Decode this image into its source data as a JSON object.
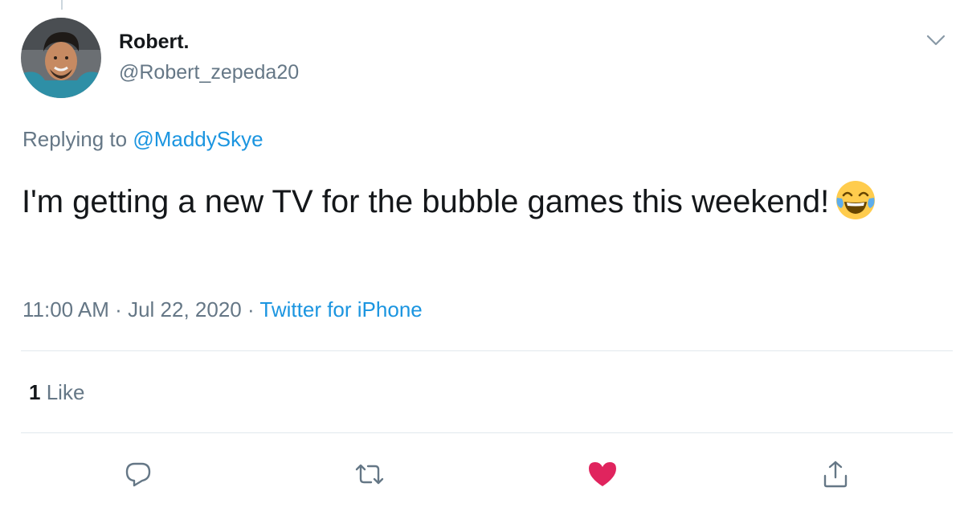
{
  "tweet": {
    "author": {
      "display_name": "Robert.",
      "handle": "@Robert_zepeda20"
    },
    "replying_prefix": "Replying to",
    "replying_handle": "@MaddySkye",
    "text": "I'm getting a new TV for the bubble games this weekend!",
    "emoji": "face-with-tears-of-joy-icon",
    "time": "11:00 AM",
    "separator_1": "·",
    "date": "Jul 22, 2020",
    "separator_2": "·",
    "source": "Twitter for iPhone",
    "likes_count": "1",
    "likes_label": "Like"
  },
  "colors": {
    "text_primary": "#14171a",
    "text_secondary": "#657786",
    "link": "#1b95e0",
    "like_heart": "#e0245e",
    "divider": "#e1e8ed"
  },
  "actions": [
    "reply-icon",
    "retweet-icon",
    "like-icon",
    "share-icon"
  ]
}
